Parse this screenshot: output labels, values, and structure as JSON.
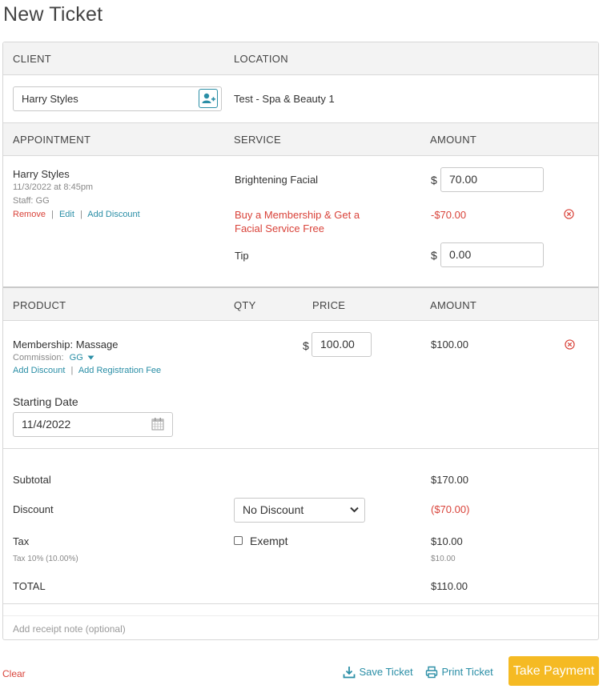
{
  "page": {
    "title": "New Ticket"
  },
  "client_section": {
    "client_header": "CLIENT",
    "location_header": "LOCATION",
    "client_value": "Harry Styles",
    "location_value": "Test - Spa & Beauty 1"
  },
  "appointment_section": {
    "headers": {
      "appointment": "APPOINTMENT",
      "service": "SERVICE",
      "amount": "AMOUNT"
    },
    "client_name": "Harry Styles",
    "datetime": "11/3/2022 at 8:45pm",
    "staff": "Staff: GG",
    "actions": {
      "remove": "Remove",
      "edit": "Edit",
      "add_discount": "Add Discount"
    },
    "service_name": "Brightening Facial",
    "currency": "$",
    "service_amount": "70.00",
    "promo_line1": "Buy a Membership & Get a",
    "promo_line2": "Facial Service Free",
    "promo_amount": "-$70.00",
    "tip_label": "Tip",
    "tip_amount": "0.00"
  },
  "product_section": {
    "headers": {
      "product": "PRODUCT",
      "qty": "QTY",
      "price": "PRICE",
      "amount": "AMOUNT"
    },
    "product_name": "Membership: Massage",
    "commission_label": "Commission:",
    "commission_value": "GG",
    "add_discount": "Add Discount",
    "add_registration_fee": "Add Registration Fee",
    "currency": "$",
    "price": "100.00",
    "amount": "$100.00",
    "starting_date_label": "Starting Date",
    "starting_date": "11/4/2022"
  },
  "totals": {
    "subtotal_label": "Subtotal",
    "subtotal": "$170.00",
    "discount_label": "Discount",
    "discount_select": "No Discount",
    "discount_amount": "($70.00)",
    "tax_label": "Tax",
    "exempt_label": "Exempt",
    "tax_amount": "$10.00",
    "tax_detail_label": "Tax 10% (10.00%)",
    "tax_detail_amount": "$10.00",
    "total_label": "TOTAL",
    "total": "$110.00"
  },
  "receipt_note": {
    "placeholder": "Add receipt note (optional)"
  },
  "footer": {
    "clear": "Clear",
    "save_ticket": "Save Ticket",
    "print_ticket": "Print Ticket",
    "take_payment": "Take Payment"
  },
  "colors": {
    "accent": "#2a8ea6",
    "danger": "#d9433a",
    "primary_button": "#f5ba23"
  }
}
